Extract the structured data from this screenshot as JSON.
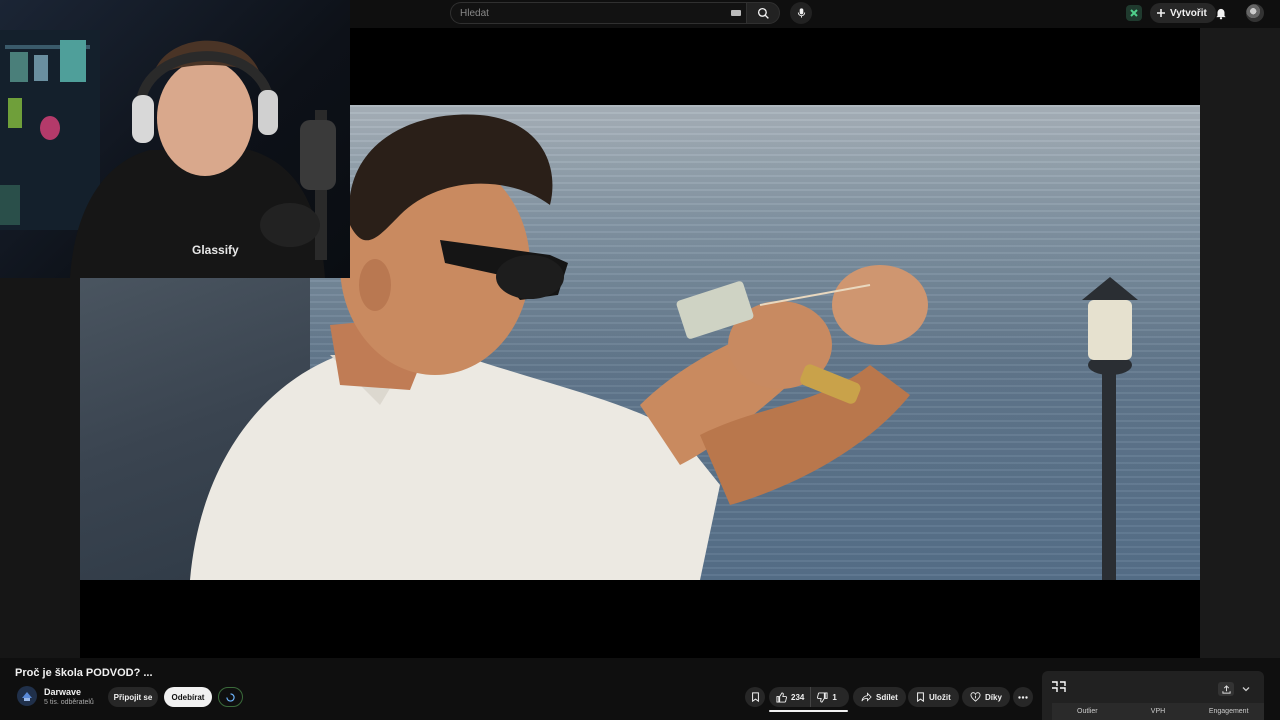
{
  "search": {
    "placeholder": "Hledat"
  },
  "header": {
    "create_label": "Vytvořit"
  },
  "video": {
    "title": "Proč je škola PODVOD? ...",
    "shirt_text": "Glassify"
  },
  "channel": {
    "name": "Darwave",
    "subscribers": "5 tis. odběratelů"
  },
  "buttons": {
    "join": "Připojit se",
    "subscribe": "Odebírat",
    "likes": "234",
    "dislikes": "1",
    "share": "Sdílet",
    "save": "Uložit",
    "thanks": "Díky"
  },
  "extension": {
    "columns": [
      "Outlier",
      "VPH",
      "Engagement"
    ]
  },
  "colors": {
    "background": "#0f0f0f",
    "button": "#272727",
    "subscribe_bg": "#f1f1f1"
  },
  "icons": [
    "keyboard-icon",
    "search-icon",
    "mic-icon",
    "extension-icon",
    "plus-icon",
    "bell-icon",
    "like-icon",
    "dislike-icon",
    "share-icon",
    "bookmark-icon",
    "heart-dollar-icon",
    "more-icon",
    "export-icon",
    "chevron-down-icon"
  ]
}
